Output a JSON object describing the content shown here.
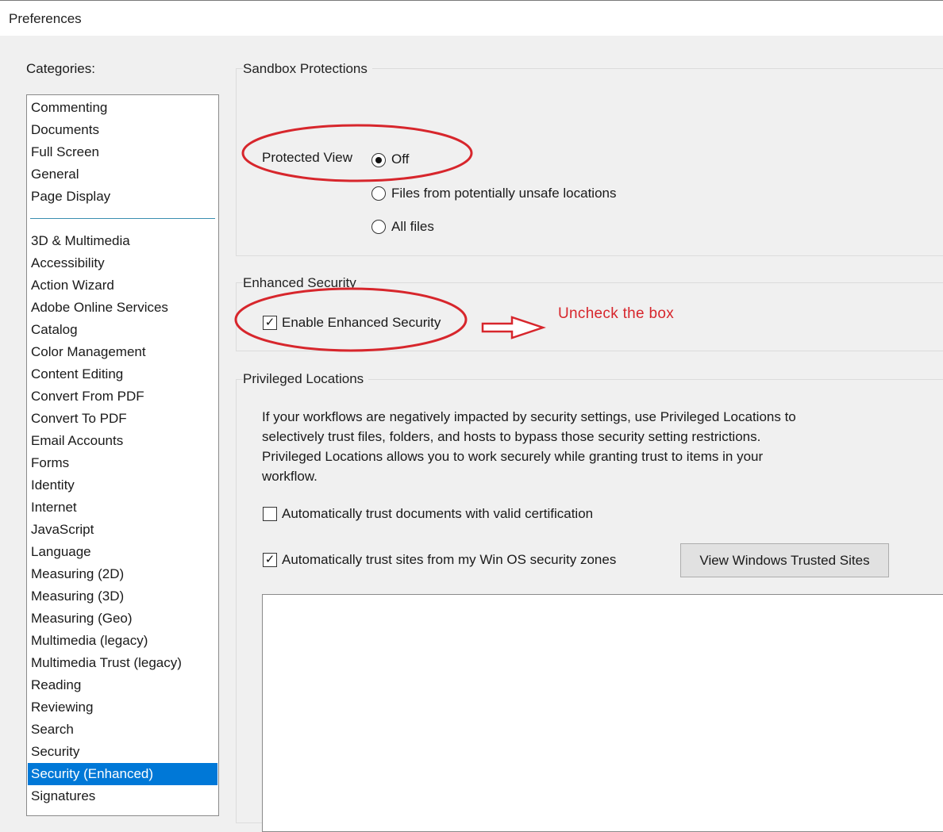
{
  "window": {
    "title": "Preferences"
  },
  "categories": {
    "label": "Categories:",
    "top_items": [
      "Commenting",
      "Documents",
      "Full Screen",
      "General",
      "Page Display"
    ],
    "items": [
      "3D & Multimedia",
      "Accessibility",
      "Action Wizard",
      "Adobe Online Services",
      "Catalog",
      "Color Management",
      "Content Editing",
      "Convert From PDF",
      "Convert To PDF",
      "Email Accounts",
      "Forms",
      "Identity",
      "Internet",
      "JavaScript",
      "Language",
      "Measuring (2D)",
      "Measuring (3D)",
      "Measuring (Geo)",
      "Multimedia (legacy)",
      "Multimedia Trust (legacy)",
      "Reading",
      "Reviewing",
      "Search",
      "Security",
      "Security (Enhanced)",
      "Signatures"
    ],
    "selected": "Security (Enhanced)"
  },
  "sandbox": {
    "title": "Sandbox Protections",
    "protected_view_label": "Protected View",
    "options": [
      "Off",
      "Files from potentially unsafe locations",
      "All files"
    ],
    "selected": "Off"
  },
  "enhanced": {
    "title": "Enhanced Security",
    "enable_label": "Enable Enhanced Security",
    "enable_checked": true
  },
  "privileged": {
    "title": "Privileged Locations",
    "description_lines": [
      "If your workflows are negatively impacted by security settings, use Privileged Locations to",
      "selectively trust files, folders, and hosts to bypass those security setting restrictions.",
      "Privileged Locations allows you to work securely while granting trust to items in your",
      "workflow."
    ],
    "trust_cert_label": "Automatically trust documents with valid certification",
    "trust_cert_checked": false,
    "trust_sites_label": "Automatically trust sites from my Win OS security zones",
    "trust_sites_checked": true,
    "view_sites_button": "View Windows Trusted Sites"
  },
  "annotation": {
    "text": "Uncheck the box",
    "color": "#d7262c"
  }
}
